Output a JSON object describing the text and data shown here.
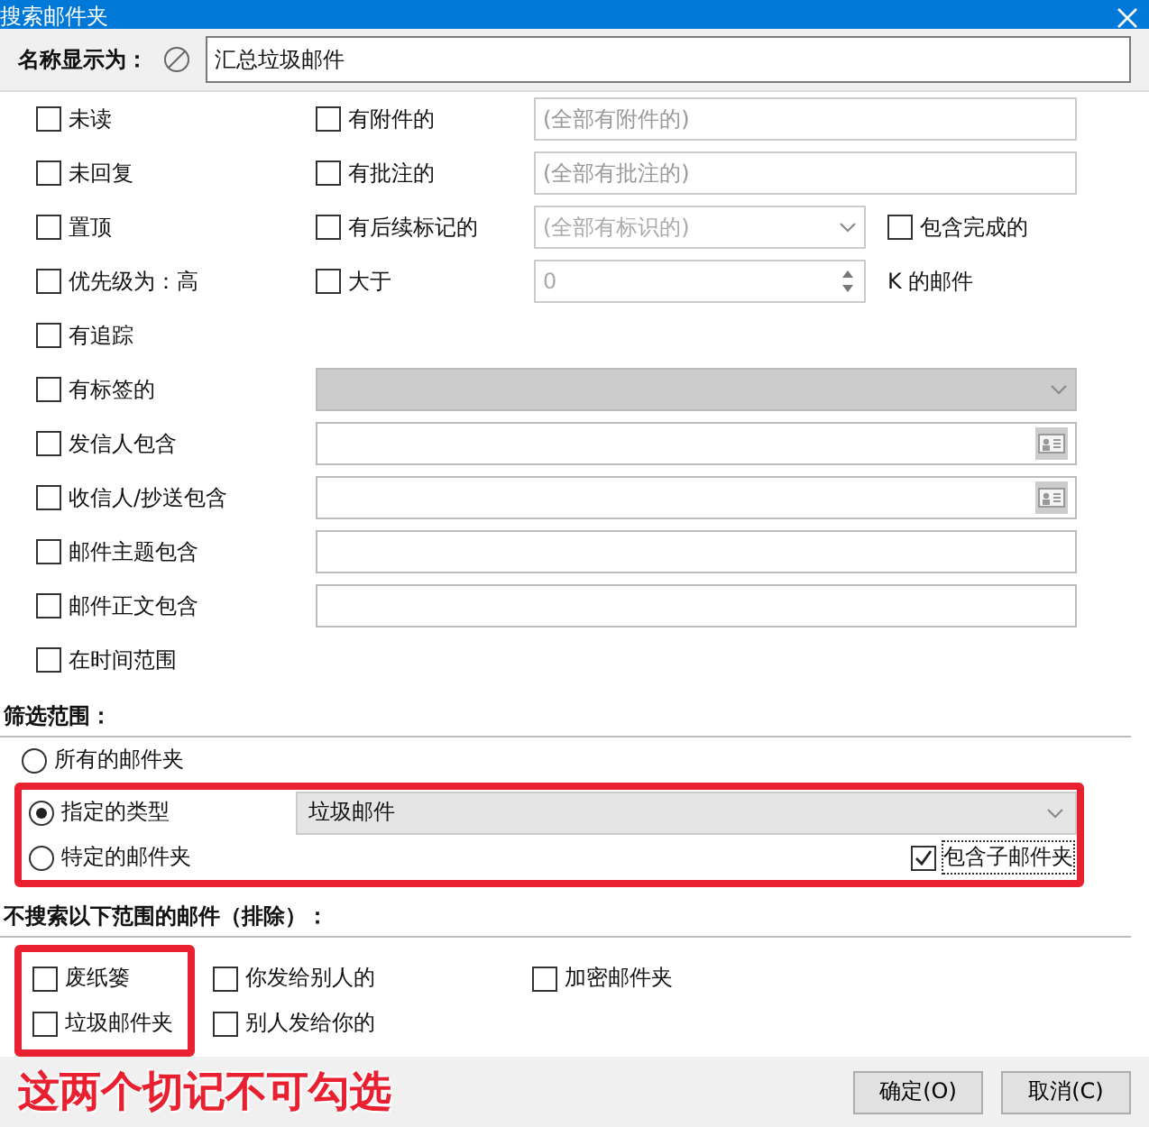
{
  "window": {
    "title": "搜索邮件夹"
  },
  "name_field": {
    "label": "名称显示为：",
    "value": "汇总垃圾邮件"
  },
  "criteria": [
    {
      "label": "未读",
      "checked": false,
      "extra": {
        "kind": "check_field",
        "label": "有附件的",
        "checked": false,
        "placeholder": "(全部有附件的)"
      }
    },
    {
      "label": "未回复",
      "checked": false,
      "extra": {
        "kind": "check_field",
        "label": "有批注的",
        "checked": false,
        "placeholder": "(全部有批注的)"
      }
    },
    {
      "label": "置顶",
      "checked": false,
      "extra": {
        "kind": "check_combo",
        "label": "有后续标记的",
        "checked": false,
        "placeholder": "(全部有标识的)",
        "option": {
          "label": "包含完成的",
          "checked": false
        }
      }
    },
    {
      "label": "优先级为：高",
      "checked": false,
      "extra": {
        "kind": "check_spin",
        "label": "大于",
        "checked": false,
        "value": "0",
        "unit": "K 的邮件"
      }
    },
    {
      "label": "有追踪",
      "checked": false
    },
    {
      "label": "有标签的",
      "checked": false,
      "extra": {
        "kind": "combo",
        "disabled": true
      }
    },
    {
      "label": "发信人包含",
      "checked": false,
      "extra": {
        "kind": "address_field"
      }
    },
    {
      "label": "收信人/抄送包含",
      "checked": false,
      "extra": {
        "kind": "address_field"
      }
    },
    {
      "label": "邮件主题包含",
      "checked": false,
      "extra": {
        "kind": "field"
      }
    },
    {
      "label": "邮件正文包含",
      "checked": false,
      "extra": {
        "kind": "field"
      }
    },
    {
      "label": "在时间范围",
      "checked": false
    }
  ],
  "scope": {
    "header": "筛选范围：",
    "all": {
      "label": "所有的邮件夹",
      "selected": false
    },
    "highlighted": true,
    "type": {
      "label": "指定的类型",
      "selected": true,
      "value": "垃圾邮件"
    },
    "folder": {
      "label": "特定的邮件夹",
      "selected": false,
      "subfolders": {
        "label": "包含子邮件夹",
        "checked": true
      }
    }
  },
  "exclude": {
    "header": "不搜索以下范围的邮件（排除）：",
    "columns": [
      {
        "highlighted": true,
        "items": [
          {
            "label": "废纸篓",
            "checked": false
          },
          {
            "label": "垃圾邮件夹",
            "checked": false
          }
        ]
      },
      {
        "highlighted": false,
        "items": [
          {
            "label": "你发给别人的",
            "checked": false
          },
          {
            "label": "别人发给你的",
            "checked": false
          }
        ]
      },
      {
        "highlighted": false,
        "items": [
          {
            "label": "加密邮件夹",
            "checked": false
          }
        ]
      }
    ]
  },
  "annotation": {
    "text": "这两个切记不可勾选"
  },
  "buttons": [
    "确定(O)",
    "取消(C)"
  ]
}
